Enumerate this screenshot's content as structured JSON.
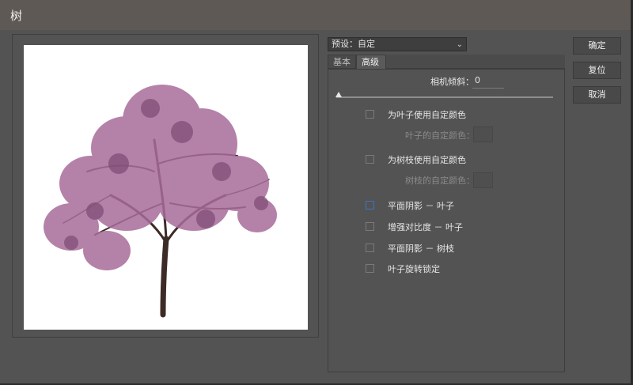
{
  "window": {
    "title": "树"
  },
  "preset": {
    "label": "预设：自定",
    "chevron_icon": "chevron-down-icon"
  },
  "tabs": [
    {
      "label": "基本"
    },
    {
      "label": "高级"
    }
  ],
  "tilt": {
    "label": "相机倾斜：",
    "value": "0",
    "slider_value": 0
  },
  "options": {
    "leaf_custom_color": {
      "label": "为叶子使用自定颜色",
      "checked": false
    },
    "leaf_color": {
      "label": "叶子的自定颜色："
    },
    "branch_custom_color": {
      "label": "为树枝使用自定颜色",
      "checked": false
    },
    "branch_color": {
      "label": "树枝的自定颜色："
    },
    "flat_shading_leaves": {
      "label": "平面阴影 － 叶子",
      "checked": false
    },
    "contrast_leaves": {
      "label": "增强对比度 － 叶子",
      "checked": false
    },
    "flat_shading_branches": {
      "label": "平面阴影 － 树枝",
      "checked": false
    },
    "leaf_rotation_lock": {
      "label": "叶子旋转锁定",
      "checked": false
    }
  },
  "buttons": {
    "ok": "确定",
    "reset": "复位",
    "cancel": "取消"
  },
  "colors": {
    "blossom": "#a86c9a",
    "trunk": "#3d2b26",
    "focus": "#3b73c6"
  }
}
